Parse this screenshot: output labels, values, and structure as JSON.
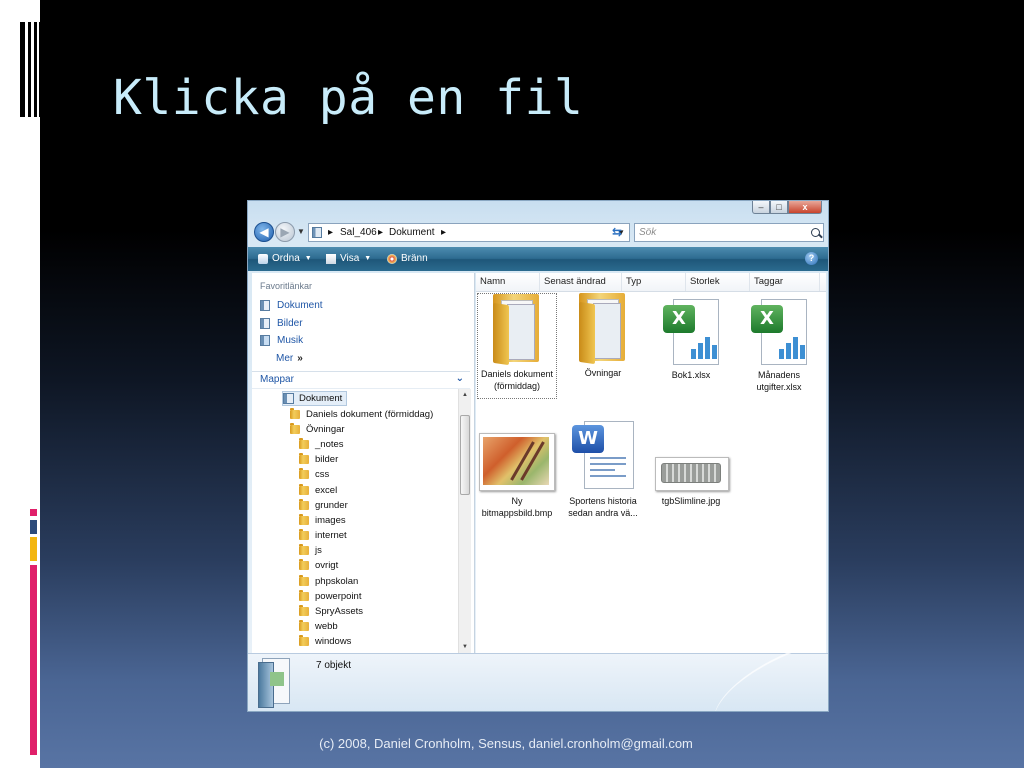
{
  "slide": {
    "title": "Klicka på en fil",
    "footer": "(c) 2008, Daniel Cronholm, Sensus, daniel.cronholm@gmail.com"
  },
  "colors": {
    "title_text": "#c8ecfa",
    "deco_pink": "#e0206a",
    "deco_yellow": "#f3b60f",
    "deco_blue": "#2d4b7a",
    "toolbar": "#2d6b90",
    "link_blue": "#1f56a6"
  },
  "window": {
    "caption_buttons": {
      "minimize": "–",
      "maximize": "□",
      "close": "x"
    },
    "address": {
      "crumbs": [
        "Sal_406",
        "Dokument"
      ],
      "separator": "▸"
    },
    "search": {
      "placeholder": "Sök"
    },
    "toolbar": {
      "organize": "Ordna",
      "views": "Visa",
      "burn": "Bränn",
      "help": "?"
    },
    "favorites": {
      "header": "Favoritlänkar",
      "items": [
        {
          "label": "Dokument",
          "icon": "documents-icon"
        },
        {
          "label": "Bilder",
          "icon": "pictures-icon"
        },
        {
          "label": "Musik",
          "icon": "music-icon"
        }
      ],
      "more": "Mer",
      "more_symbol": "»"
    },
    "folders": {
      "header": "Mappar",
      "tree": [
        {
          "label": "Dokument",
          "level": 0,
          "selected": true
        },
        {
          "label": "Daniels dokument (förmiddag)",
          "level": 1
        },
        {
          "label": "Övningar",
          "level": 1
        },
        {
          "label": "_notes",
          "level": 2
        },
        {
          "label": "bilder",
          "level": 2
        },
        {
          "label": "css",
          "level": 2
        },
        {
          "label": "excel",
          "level": 2
        },
        {
          "label": "grunder",
          "level": 2
        },
        {
          "label": "images",
          "level": 2
        },
        {
          "label": "internet",
          "level": 2
        },
        {
          "label": "js",
          "level": 2
        },
        {
          "label": "ovrigt",
          "level": 2
        },
        {
          "label": "phpskolan",
          "level": 2
        },
        {
          "label": "powerpoint",
          "level": 2
        },
        {
          "label": "SpryAssets",
          "level": 2
        },
        {
          "label": "webb",
          "level": 2
        },
        {
          "label": "windows",
          "level": 2
        }
      ]
    },
    "columns": [
      "Namn",
      "Senast ändrad",
      "Typ",
      "Storlek",
      "Taggar"
    ],
    "files": [
      {
        "name": "Daniels dokument (förmiddag)",
        "kind": "folder",
        "selected": true
      },
      {
        "name": "Övningar",
        "kind": "folder"
      },
      {
        "name": "Bok1.xlsx",
        "kind": "xlsx"
      },
      {
        "name": "Månadens utgifter.xlsx",
        "kind": "xlsx"
      },
      {
        "name": "Ny bitmappsbild.bmp",
        "kind": "bmp"
      },
      {
        "name": "Sportens historia sedan andra vä...",
        "kind": "docx"
      },
      {
        "name": "tgbSlimline.jpg",
        "kind": "jpg"
      }
    ],
    "status": {
      "count_text": "7 objekt"
    }
  }
}
